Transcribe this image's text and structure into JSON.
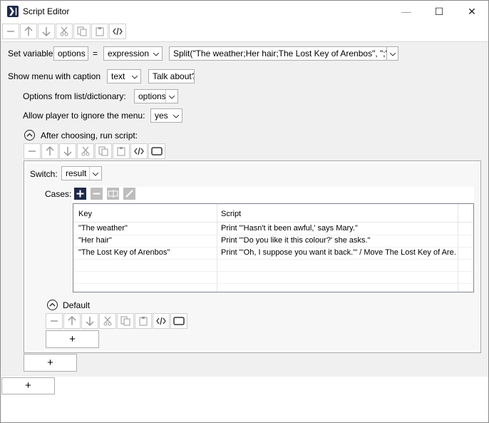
{
  "window": {
    "title": "Script Editor",
    "minimize": "—",
    "maximize": "☐",
    "close": "✕",
    "app_icon": "❯|"
  },
  "toolbar": {
    "icons": [
      "minus-icon",
      "arrow-up-icon",
      "arrow-down-icon",
      "scissors-icon",
      "copy-icon",
      "paste-icon",
      "code-icon"
    ]
  },
  "set_variable": {
    "label": "Set variable",
    "variable": "options",
    "equals": "=",
    "type": "expression",
    "expression": "Split(\"The weather;Her hair;The Lost Key of Arenbos\", \";\")"
  },
  "show_menu": {
    "label": "Show menu with caption",
    "caption_type": "text",
    "caption_value": "Talk about?",
    "options_label": "Options from list/dictionary:",
    "options_value": "options",
    "ignore_label": "Allow player to ignore the menu:",
    "ignore_value": "yes"
  },
  "after_choosing": {
    "label": "After choosing, run script:"
  },
  "switch": {
    "label": "Switch:",
    "value": "result",
    "cases_label": "Cases:",
    "columns": [
      "Key",
      "Script"
    ],
    "rows": [
      {
        "key": "\"The weather\"",
        "script": "Print \"'Hasn't it been awful,' says Mary.\""
      },
      {
        "key": "\"Her hair\"",
        "script": "Print \"'Do you like it this colour?' she asks.\""
      },
      {
        "key": "\"The Lost Key of Arenbos\"",
        "script": "Print \"'Oh, I suppose you want it back.'\" / Move The Lost Key of Are..."
      }
    ]
  },
  "default": {
    "label": "Default"
  },
  "add_symbol": "+",
  "colors": {
    "panel_bg": "#f0f0f0",
    "inner_bg": "#f7f7f7",
    "icon_gray": "#9a9a9a",
    "add_case_bg": "#1f2a4a"
  }
}
